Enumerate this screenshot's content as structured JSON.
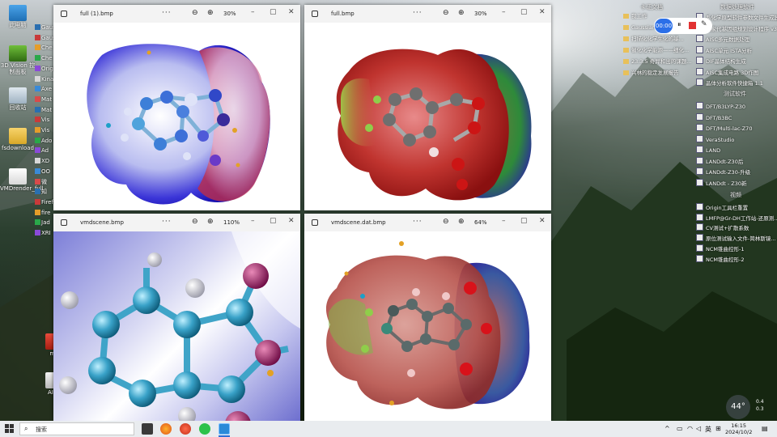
{
  "desktop": {
    "left_icons": [
      {
        "label": "此电脑",
        "icon": "computer-icon"
      },
      {
        "label": "3D Vision 控制面板",
        "icon": "nvidia-icon"
      },
      {
        "label": "回收站",
        "icon": "recycle-bin-icon"
      },
      {
        "label": "fsdownload",
        "icon": "folder-icon"
      },
      {
        "label": "VMDrender_full",
        "icon": "image-file-icon"
      }
    ],
    "side_icons": [
      "Gaus",
      "Gaus",
      "Che",
      "Che",
      "Origi",
      "Kina",
      "Axe",
      "Mat",
      "Mat",
      "Vis",
      "Vis",
      "Ado",
      "Ad",
      "XD",
      "OO",
      "微",
      "知",
      "Firef",
      "fire",
      "Jad",
      "XRI"
    ],
    "bottom_icons": [
      {
        "label": "mp",
        "icon": "pdf-icon"
      },
      {
        "label": "AI 标",
        "icon": "document-icon"
      }
    ]
  },
  "windows": [
    {
      "title": "full (1).bmp",
      "zoom": "30%",
      "more": "···"
    },
    {
      "title": "full.bmp",
      "zoom": "30%",
      "more": "···"
    },
    {
      "title": "vmdscene.bmp",
      "zoom": "110%",
      "more": "···"
    },
    {
      "title": "vmdscene.dat.bmp",
      "zoom": "64%",
      "more": "···"
    }
  ],
  "right_panel": {
    "col1_header": "卡证文档",
    "col2_header": "数据处理软件",
    "col1_items": [
      "我工作",
      "Gaussian 全...",
      "扫描化化学生化的基...",
      "催化化学能源——细化...",
      "23.3.5 奇异和出的课题...",
      "兴林的稳定发展报告"
    ],
    "col2_items": [
      "系化学原型软件参数文件生成器...",
      "国家代基因组规划设计程序 v3.1",
      "AISC多元数据处理",
      "AISC单元 ISTA分析",
      "DIF晶体结构生成",
      "AISC集成电路 3D作图",
      "晶体分析软件快捷箱 1.1"
    ],
    "section2_header": "测试软件",
    "section2_items": [
      "DFT/B3LYP-Z30",
      "DFT/B3BC",
      "DFT/Multi-lac-Z70",
      "VeraStudio",
      "LAND",
      "LANDdt-Z30后",
      "LANDdt-Z30-升级",
      "LANDdt - Z30新"
    ],
    "section3_header": "视频",
    "section3_items": [
      "Origin工具栏重置",
      "LMFP@Gr-DH工作站-还原测...",
      "CV测试+扩散系数",
      "原位测试输入文件-简林斯镜...",
      "NCM锥曲控形-1",
      "NCM锥曲控形-2"
    ]
  },
  "recorder": {
    "time": "00:00"
  },
  "weather": {
    "temp": "44",
    "unit": "°",
    "up": "0.4",
    "down": "0.3"
  },
  "taskbar": {
    "search_placeholder": "搜索",
    "tray": {
      "ime": "英",
      "time": "16:15",
      "date": "2024/10/2"
    }
  }
}
